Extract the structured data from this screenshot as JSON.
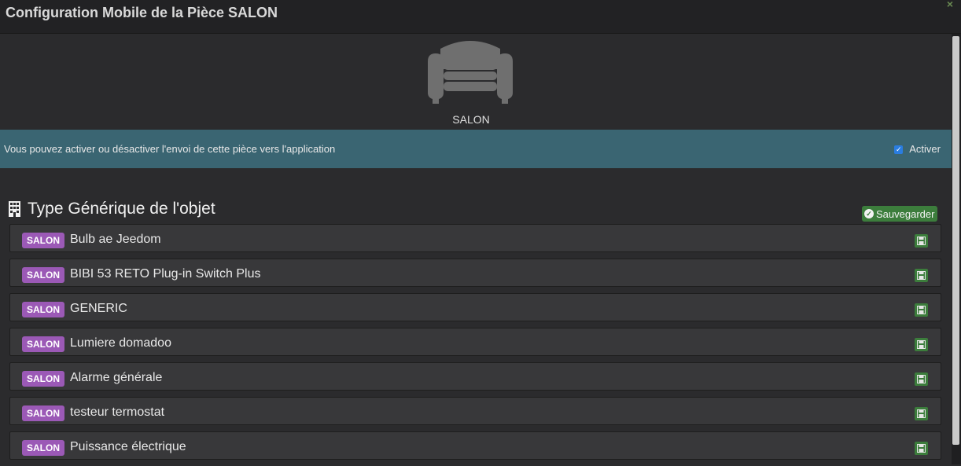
{
  "window": {
    "title": "Configuration Mobile de la Pièce SALON",
    "close_icon": "×"
  },
  "room": {
    "icon": "sofa-icon",
    "name": "SALON"
  },
  "info": {
    "text": "Vous pouvez activer ou désactiver l'envoi de cette pièce vers l'application",
    "activate_label": "Activer",
    "activate_checked": true
  },
  "section": {
    "icon": "building-icon",
    "title": "Type Générique de l'objet",
    "save_label": "Sauvegarder"
  },
  "colors": {
    "badge": "#9b59b6",
    "save_green": "#3c7d3c",
    "info_band": "#3a6572"
  },
  "items": [
    {
      "badge": "SALON",
      "label": "Bulb ae Jeedom"
    },
    {
      "badge": "SALON",
      "label": "BIBI 53 RETO Plug-in Switch Plus"
    },
    {
      "badge": "SALON",
      "label": "GENERIC"
    },
    {
      "badge": "SALON",
      "label": "Lumiere domadoo"
    },
    {
      "badge": "SALON",
      "label": "Alarme générale"
    },
    {
      "badge": "SALON",
      "label": "testeur termostat"
    },
    {
      "badge": "SALON",
      "label": "Puissance électrique"
    }
  ]
}
